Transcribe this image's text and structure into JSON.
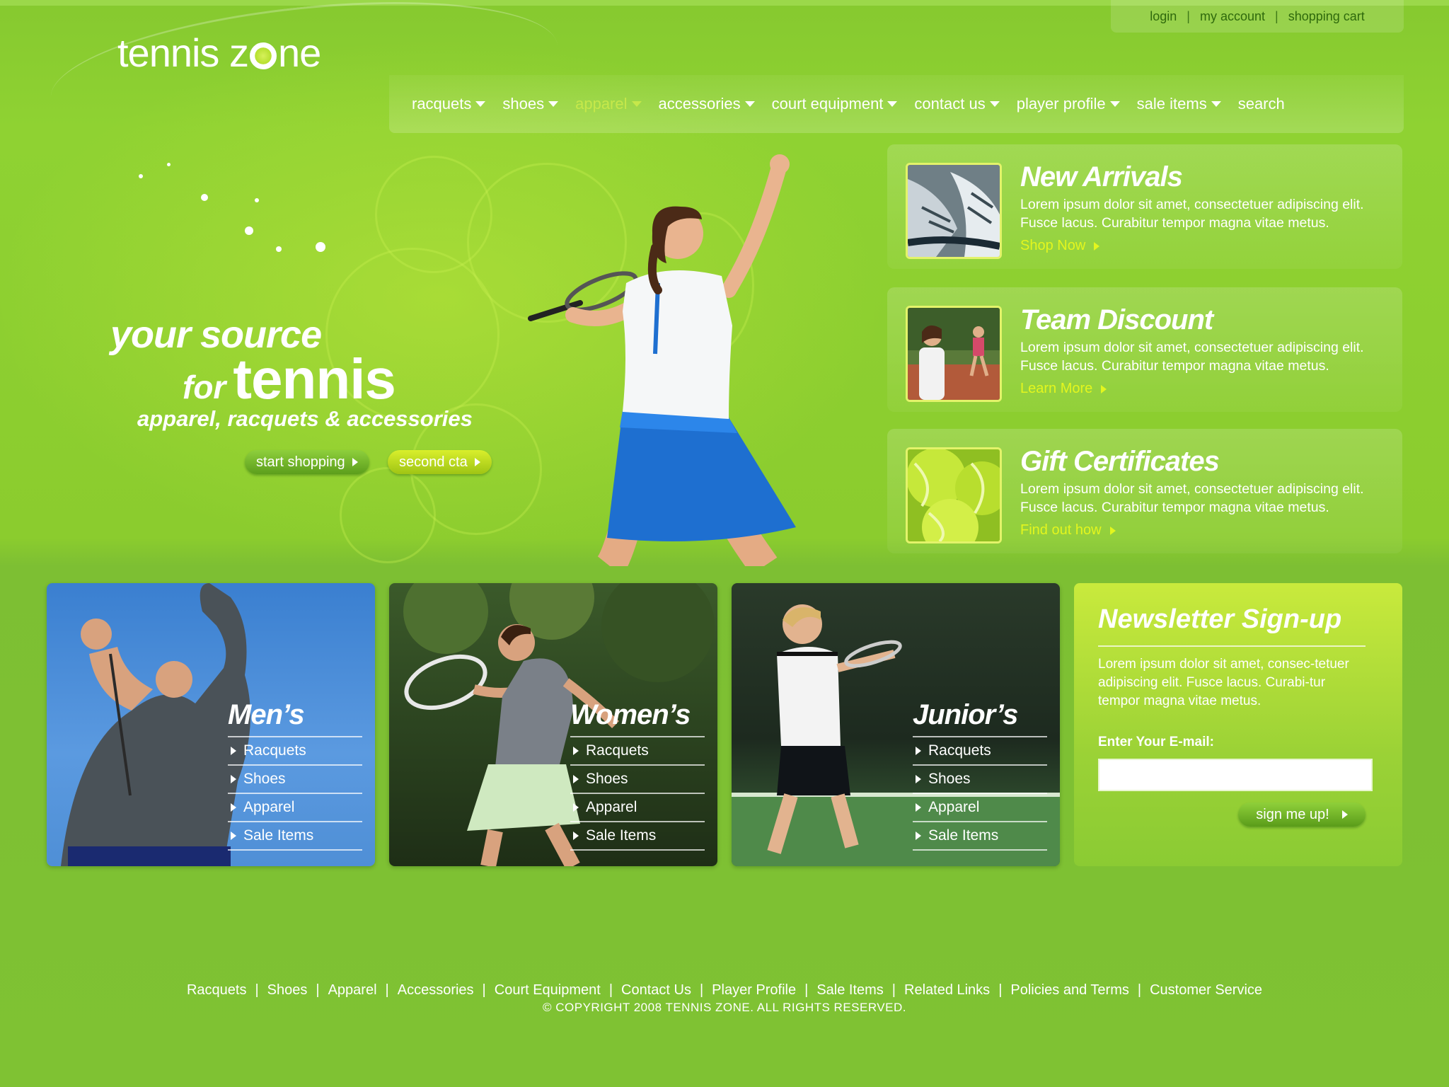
{
  "brand": {
    "name_part1": "tennis z",
    "name_part2": "ne"
  },
  "util_nav": {
    "login": "login",
    "my_account": "my account",
    "shopping_cart": "shopping cart",
    "separator": "|"
  },
  "main_nav": {
    "items": [
      {
        "label": "racquets",
        "dropdown": true,
        "active": false
      },
      {
        "label": "shoes",
        "dropdown": true,
        "active": false
      },
      {
        "label": "apparel",
        "dropdown": true,
        "active": true
      },
      {
        "label": "accessories",
        "dropdown": true,
        "active": false
      },
      {
        "label": "court equipment",
        "dropdown": true,
        "active": false
      },
      {
        "label": "contact us",
        "dropdown": true,
        "active": false
      },
      {
        "label": "player profile",
        "dropdown": true,
        "active": false
      },
      {
        "label": "sale items",
        "dropdown": true,
        "active": false
      },
      {
        "label": "search",
        "dropdown": false,
        "active": false
      }
    ]
  },
  "hero": {
    "line1": "your source",
    "line2_for": "for",
    "line2_big": "tennis",
    "line3": "apparel, racquets & accessories",
    "cta_primary": "start shopping",
    "cta_secondary": "second cta"
  },
  "promos": [
    {
      "title": "New Arrivals",
      "body": "Lorem ipsum dolor sit amet, consectetuer adipiscing elit. Fusce lacus. Curabitur tempor magna vitae metus.",
      "link": "Shop Now"
    },
    {
      "title": "Team Discount",
      "body": "Lorem ipsum dolor sit amet, consectetuer adipiscing elit. Fusce lacus. Curabitur tempor magna vitae metus.",
      "link": "Learn More"
    },
    {
      "title": "Gift Certificates",
      "body": "Lorem ipsum dolor sit amet, consectetuer adipiscing elit. Fusce lacus. Curabitur tempor magna vitae metus.",
      "link": "Find out how"
    }
  ],
  "categories": [
    {
      "title": "Men’s",
      "items": [
        "Racquets",
        "Shoes",
        "Apparel",
        "Sale Items"
      ]
    },
    {
      "title": "Women’s",
      "items": [
        "Racquets",
        "Shoes",
        "Apparel",
        "Sale Items"
      ]
    },
    {
      "title": "Junior’s",
      "items": [
        "Racquets",
        "Shoes",
        "Apparel",
        "Sale Items"
      ]
    }
  ],
  "newsletter": {
    "title": "Newsletter Sign-up",
    "body": "Lorem ipsum dolor sit amet, consec-tetuer adipiscing elit. Fusce lacus. Curabi-tur tempor magna vitae metus.",
    "email_label": "Enter Your E-mail:",
    "email_value": "",
    "email_placeholder": "",
    "submit": "sign me up!"
  },
  "footer": {
    "links": [
      "Racquets",
      "Shoes",
      "Apparel",
      "Accessories",
      "Court Equipment",
      "Contact Us",
      "Player Profile",
      "Sale Items",
      "Related Links",
      "Policies and Terms",
      "Customer Service"
    ],
    "separator": "|",
    "copyright": "© COPYRIGHT 2008 TENNIS ZONE. ALL RIGHTS RESERVED."
  },
  "colors": {
    "accent_yellow": "#e3f61e",
    "nav_active": "#c6e84a",
    "bg_green": "#7fc22e"
  }
}
